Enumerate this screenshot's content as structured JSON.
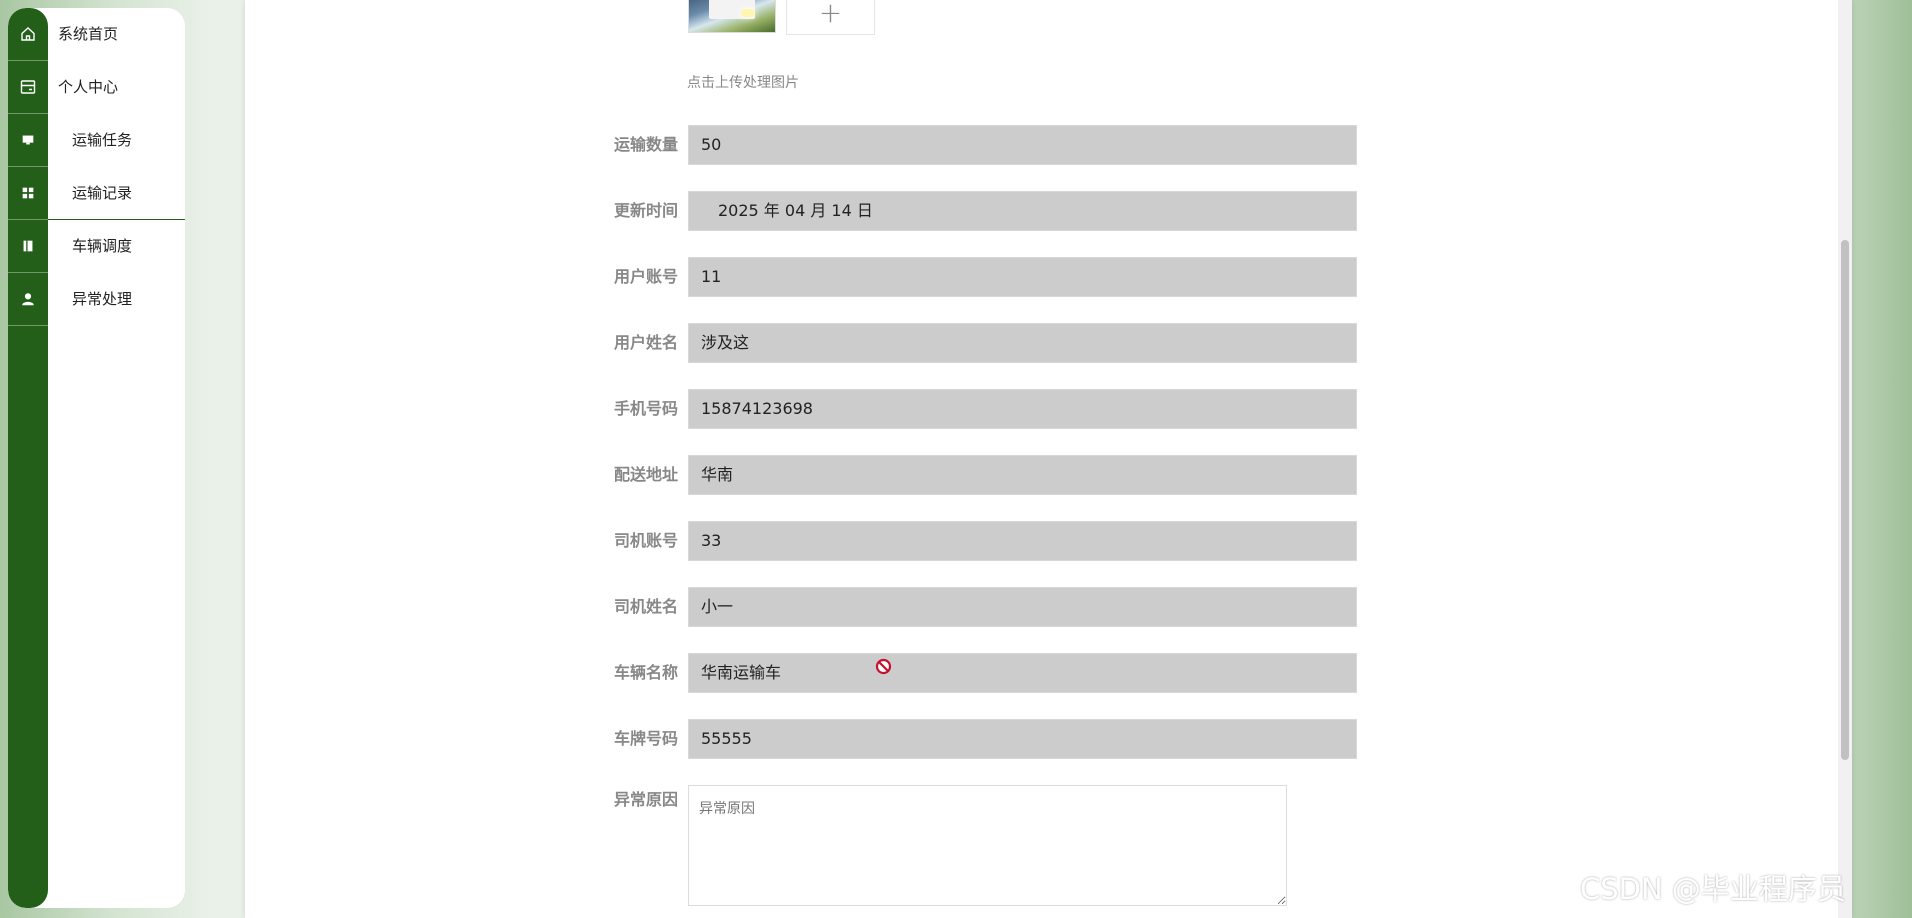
{
  "sidebar": {
    "items": [
      {
        "label": "系统首页",
        "icon": "home-icon"
      },
      {
        "label": "个人中心",
        "icon": "card-icon"
      },
      {
        "label": "运输任务",
        "icon": "monitor-icon"
      },
      {
        "label": "运输记录",
        "icon": "grid-icon"
      },
      {
        "label": "车辆调度",
        "icon": "book-icon"
      },
      {
        "label": "异常处理",
        "icon": "user-icon"
      }
    ]
  },
  "form": {
    "upload": {
      "plus": "+",
      "hint": "点击上传处理图片"
    },
    "fields": [
      {
        "label": "运输数量",
        "value": "50"
      },
      {
        "label": "更新时间",
        "value": "2025 年 04 月 14 日"
      },
      {
        "label": "用户账号",
        "value": "11"
      },
      {
        "label": "用户姓名",
        "value": "涉及这"
      },
      {
        "label": "手机号码",
        "value": "15874123698"
      },
      {
        "label": "配送地址",
        "value": "华南"
      },
      {
        "label": "司机账号",
        "value": "33"
      },
      {
        "label": "司机姓名",
        "value": "小一"
      },
      {
        "label": "车辆名称",
        "value": "华南运输车"
      },
      {
        "label": "车牌号码",
        "value": "55555"
      }
    ],
    "reason": {
      "label": "异常原因",
      "placeholder": "异常原因"
    }
  },
  "watermark": "CSDN @毕业程序员",
  "colors": {
    "sidebar_rail": "#245f1a",
    "input_bg": "#cccccc",
    "label_color": "#888888"
  }
}
